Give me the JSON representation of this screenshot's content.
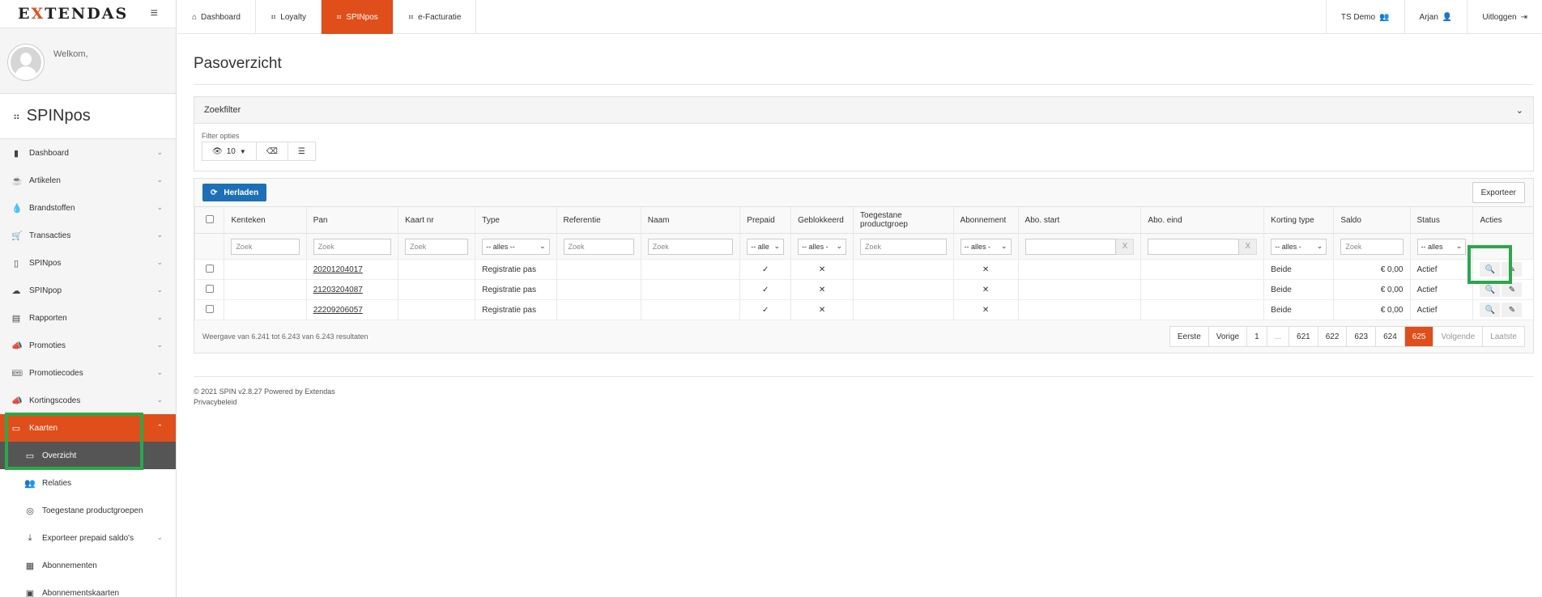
{
  "brand": {
    "logo_pre": "E",
    "logo_x": "X",
    "logo_post": "TENDAS"
  },
  "user": {
    "welcome": "Welkom,"
  },
  "module": {
    "title": "SPINpos"
  },
  "sidebar": {
    "items": [
      {
        "label": "Dashboard"
      },
      {
        "label": "Artikelen"
      },
      {
        "label": "Brandstoffen"
      },
      {
        "label": "Transacties"
      },
      {
        "label": "SPINpos"
      },
      {
        "label": "SPINpop"
      },
      {
        "label": "Rapporten"
      },
      {
        "label": "Promoties"
      },
      {
        "label": "Promotiecodes"
      },
      {
        "label": "Kortingscodes"
      },
      {
        "label": "Kaarten"
      }
    ],
    "sub": [
      {
        "label": "Overzicht"
      },
      {
        "label": "Relaties"
      },
      {
        "label": "Toegestane productgroepen"
      },
      {
        "label": "Exporteer prepaid saldo's"
      },
      {
        "label": "Abonnementen"
      },
      {
        "label": "Abonnementskaarten"
      }
    ]
  },
  "topnav": {
    "tabs": [
      {
        "label": "Dashboard"
      },
      {
        "label": "Loyalty"
      },
      {
        "label": "SPINpos"
      },
      {
        "label": "e-Facturatie"
      }
    ],
    "right": [
      {
        "label": "TS Demo"
      },
      {
        "label": "Arjan"
      },
      {
        "label": "Uitloggen"
      }
    ]
  },
  "page": {
    "title": "Pasoverzicht"
  },
  "filter": {
    "title": "Zoekfilter",
    "options_label": "Filter opties",
    "page_size": "10"
  },
  "grid": {
    "reload": "Herladen",
    "export": "Exporteer",
    "headers": [
      "Kenteken",
      "Pan",
      "Kaart nr",
      "Type",
      "Referentie",
      "Naam",
      "Prepaid",
      "Geblokkeerd",
      "Toegestane productgroep",
      "Abonnement",
      "Abo. start",
      "Abo. eind",
      "Korting type",
      "Saldo",
      "Status",
      "Acties"
    ],
    "filters": {
      "search": "Zoek",
      "all": "-- alles --",
      "all_short": "-- alle",
      "all_dash": "-- alles -",
      "all_short2": "-- alles",
      "clear": "X"
    },
    "rows": [
      {
        "pan": "20201204017",
        "type": "Registratie pas",
        "prepaid": "✓",
        "blocked": "✕",
        "subscription": "✕",
        "discount": "Beide",
        "balance": "€ 0,00",
        "status": "Actief"
      },
      {
        "pan": "21203204087",
        "type": "Registratie pas",
        "prepaid": "✓",
        "blocked": "✕",
        "subscription": "✕",
        "discount": "Beide",
        "balance": "€ 0,00",
        "status": "Actief"
      },
      {
        "pan": "22209206057",
        "type": "Registratie pas",
        "prepaid": "✓",
        "blocked": "✕",
        "subscription": "✕",
        "discount": "Beide",
        "balance": "€ 0,00",
        "status": "Actief"
      }
    ],
    "summary": "Weergave van 6.241 tot 6.243 van 6.243 resultaten",
    "pager": {
      "first": "Eerste",
      "prev": "Vorige",
      "p1": "1",
      "ellipsis": "...",
      "p621": "621",
      "p622": "622",
      "p623": "623",
      "p624": "624",
      "p625": "625",
      "next": "Volgende",
      "last": "Laatste"
    }
  },
  "footer": {
    "copyright": "© 2021 SPIN v2.8.27 Powered by Extendas",
    "privacy": "Privacybeleid"
  },
  "colors": {
    "accent": "#e04e1b",
    "primary": "#1d6fb8",
    "highlight": "#2aa84a"
  }
}
